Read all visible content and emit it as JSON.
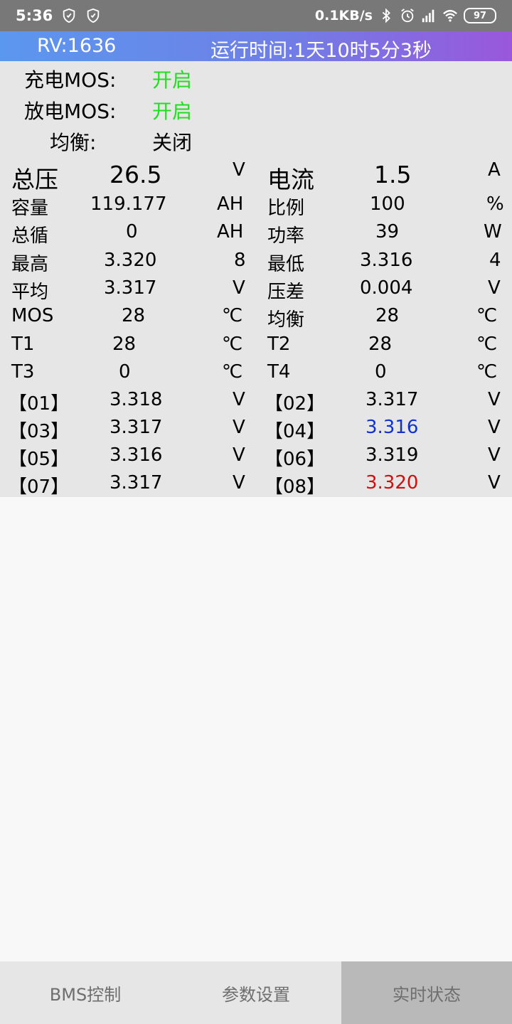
{
  "status_bar": {
    "time": "5:36",
    "net_speed": "0.1KB/s",
    "battery": "97",
    "icons": [
      "shield-icon",
      "shield-icon",
      "bluetooth-icon",
      "alarm-icon",
      "signal-icon",
      "wifi-icon",
      "battery-icon"
    ]
  },
  "header": {
    "rv": "RV:1636",
    "runtime": "运行时间:1天10时5分3秒",
    "gradient": [
      "#5b97ef",
      "#9a57dc"
    ]
  },
  "mos": [
    {
      "label": "充电MOS:",
      "value": "开启",
      "on": true
    },
    {
      "label": "放电MOS:",
      "value": "开启",
      "on": true
    },
    {
      "label": "均衡:",
      "value": "关闭",
      "on": false
    }
  ],
  "summary": {
    "left": [
      {
        "label": "总压",
        "value": "26.5",
        "unit": "V"
      },
      {
        "label": "容量",
        "value": "119.177",
        "unit": "AH"
      },
      {
        "label": "总循",
        "value": "0",
        "unit": "AH"
      },
      {
        "label": "最高",
        "value": "3.320",
        "unit": "8"
      },
      {
        "label": "平均",
        "value": "3.317",
        "unit": "V"
      },
      {
        "label": "MOS",
        "value": "28",
        "unit": "℃"
      },
      {
        "label": "T1",
        "value": "28",
        "unit": "℃"
      },
      {
        "label": "T3",
        "value": "0",
        "unit": "℃"
      }
    ],
    "right": [
      {
        "label": "电流",
        "value": "1.5",
        "unit": "A"
      },
      {
        "label": "比例",
        "value": "100",
        "unit": "%"
      },
      {
        "label": "功率",
        "value": "39",
        "unit": "W"
      },
      {
        "label": "最低",
        "value": "3.316",
        "unit": "4"
      },
      {
        "label": "压差",
        "value": "0.004",
        "unit": "V"
      },
      {
        "label": "均衡",
        "value": "28",
        "unit": "℃"
      },
      {
        "label": "T2",
        "value": "28",
        "unit": "℃"
      },
      {
        "label": "T4",
        "value": "0",
        "unit": "℃"
      }
    ]
  },
  "cells": [
    {
      "label": "【01】",
      "value": "3.318",
      "unit": "V",
      "color": "#000000"
    },
    {
      "label": "【02】",
      "value": "3.317",
      "unit": "V",
      "color": "#000000"
    },
    {
      "label": "【03】",
      "value": "3.317",
      "unit": "V",
      "color": "#000000"
    },
    {
      "label": "【04】",
      "value": "3.316",
      "unit": "V",
      "color": "#1133cc"
    },
    {
      "label": "【05】",
      "value": "3.316",
      "unit": "V",
      "color": "#000000"
    },
    {
      "label": "【06】",
      "value": "3.319",
      "unit": "V",
      "color": "#000000"
    },
    {
      "label": "【07】",
      "value": "3.317",
      "unit": "V",
      "color": "#000000"
    },
    {
      "label": "【08】",
      "value": "3.320",
      "unit": "V",
      "color": "#cc1111"
    }
  ],
  "nav": {
    "tabs": [
      "BMS控制",
      "参数设置",
      "实时状态"
    ],
    "active_index": 2
  }
}
